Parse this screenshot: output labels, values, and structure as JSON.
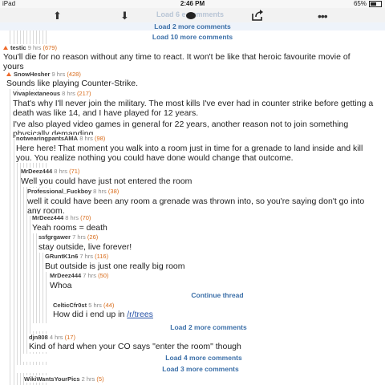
{
  "status": {
    "device": "iPad",
    "time": "2:46 PM",
    "battery": "65%"
  },
  "toolbar": {
    "faded_text": "Load 6   e comments",
    "icons": [
      "up-arrow-icon",
      "down-arrow-icon",
      "comment-bubble-icon",
      "share-icon",
      "more-icon"
    ]
  },
  "colors": {
    "link": "#3b6fa8",
    "score": "#d86b1a",
    "upvote": "#ef6a2b"
  },
  "top_loads": [
    "Load 2 more comments",
    "Load 10 more comments"
  ],
  "comments": [
    {
      "user": "testic",
      "time": "9 hrs",
      "score": "(679)",
      "text": "You'll die for no reason without any time to react. It won't be like that heroic favourite movie of yours"
    },
    {
      "user": "SnowHesher",
      "time": "9 hrs",
      "score": "(428)",
      "text": "Sounds like playing Counter-Strike."
    },
    {
      "user": "Vivaplextaneous",
      "time": "8 hrs",
      "score": "(217)",
      "text": "That's why I'll never join the military. The most kills I've ever had in counter strike before getting a death was like 14,  and I have played for 12 years.",
      "text2": "I've also played video games in general for 22 years, another reason not to join something physically demanding."
    },
    {
      "user": "notwearingpantsAMA",
      "time": "8 hrs",
      "score": "(98)",
      "text": "Here here! That moment you walk into a room just in time for a grenade to land inside and kill you. You realize nothing you could have done would change that outcome."
    },
    {
      "user": "MrDeez444",
      "time": "8 hrs",
      "score": "(71)",
      "text": "Well you could have just not entered the room"
    },
    {
      "user": "Professional_Fuckboy",
      "time": "8 hrs",
      "score": "(38)",
      "text": "well it could have been any room a grenade was thrown into, so you're saying don't go into any room."
    },
    {
      "user": "MrDeez444",
      "time": "8 hrs",
      "score": "(70)",
      "text": "Yeah rooms = death"
    },
    {
      "user": "ssfgrgawer",
      "time": "7 hrs",
      "score": "(26)",
      "text": "stay outside, live forever!"
    },
    {
      "user": "GRuntK1n6",
      "time": "7 hrs",
      "score": "(116)",
      "text": "But outside is just one really big room"
    },
    {
      "user": "MrDeez444",
      "time": "7 hrs",
      "score": "(50)",
      "text": "Whoa"
    },
    {
      "user": "CelticCfr0st",
      "time": "5 hrs",
      "score": "(44)",
      "text": "How did i end up in ",
      "link": "/r/trees"
    },
    {
      "user": "djn808",
      "time": "4 hrs",
      "score": "(17)",
      "text": "Kind of hard when your CO says \"enter the room\" though"
    },
    {
      "user": "WikiWantsYourPics",
      "time": "2 hrs",
      "score": "(5)",
      "text": ""
    }
  ],
  "continue_thread": "Continue thread",
  "bottom_loads": [
    "Load 2 more comments",
    "Load 4 more comments",
    "Load 3 more comments"
  ]
}
